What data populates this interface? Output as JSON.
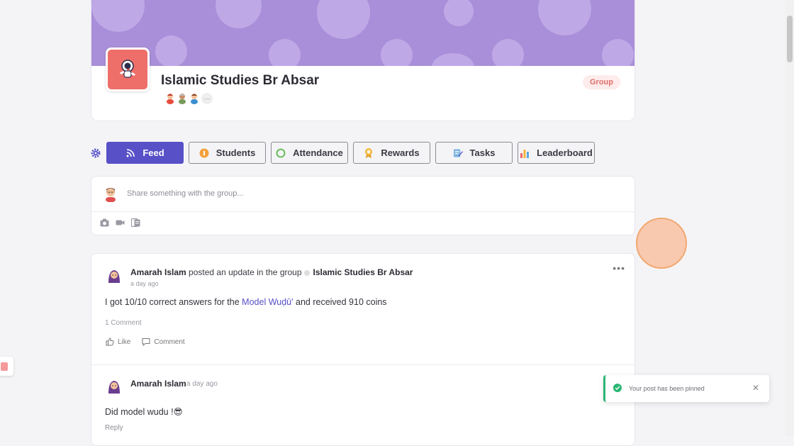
{
  "group": {
    "title": "Islamic Studies Br Absar",
    "badge": "Group",
    "members_more": "···"
  },
  "tabs": [
    {
      "label": "Feed",
      "icon": "rss-icon",
      "active": true
    },
    {
      "label": "Students",
      "icon": "coin-icon"
    },
    {
      "label": "Attendance",
      "icon": "circle-icon"
    },
    {
      "label": "Rewards",
      "icon": "ribbon-icon"
    },
    {
      "label": "Tasks",
      "icon": "notepad-icon"
    },
    {
      "label": "Leaderboard",
      "icon": "bar-chart-icon"
    }
  ],
  "composer": {
    "placeholder": "Share something with the group..."
  },
  "post": {
    "author": "Amarah Islam",
    "action_text": "posted an update in the group",
    "group_name": "Islamic Studies Br Absar",
    "time": "a day ago",
    "body_prefix": "I got 10/10 correct answers for the",
    "body_link": "Model Wuḍū'",
    "body_suffix": "and received 910 coins",
    "comment_count": "1 Comment",
    "like_label": "Like",
    "comment_label": "Comment",
    "more": "•••"
  },
  "comment": {
    "author": "Amarah Islam",
    "time": "a day ago",
    "text": "Did model wudu !😎",
    "reply_label": "Reply"
  },
  "toast": {
    "message": "Your post has been pinned",
    "close": "✕"
  },
  "colors": {
    "accent": "#5750c7",
    "banner": "#a98ed9",
    "group_badge": "#e06e6a",
    "toast_success": "#2bb673"
  }
}
